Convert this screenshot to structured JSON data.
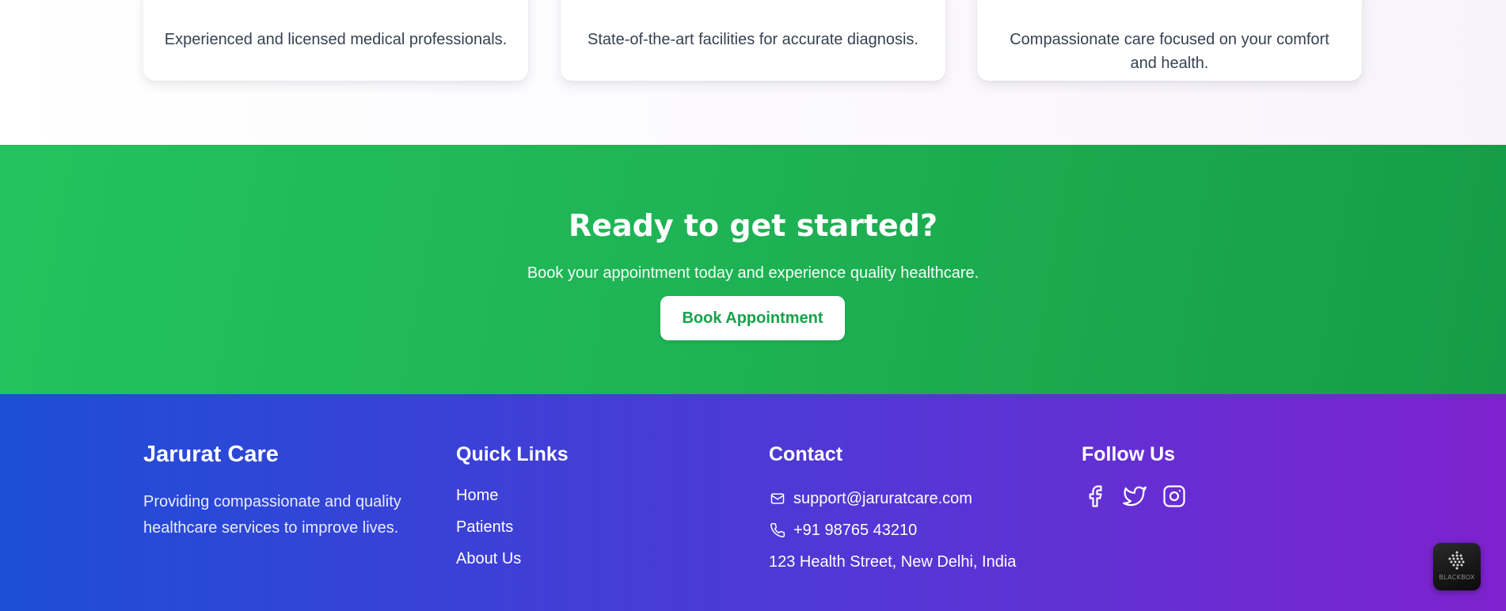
{
  "features": {
    "cards": [
      {
        "text": "Experienced and licensed medical professionals."
      },
      {
        "text": "State-of-the-art facilities for accurate diagnosis."
      },
      {
        "text": "Compassionate care focused on your comfort and health."
      }
    ]
  },
  "cta": {
    "title": "Ready to get started?",
    "subtitle": "Book your appointment today and experience quality healthcare.",
    "button_label": "Book Appointment"
  },
  "footer": {
    "brand": {
      "name": "Jarurat Care",
      "tagline": "Providing compassionate and quality healthcare services to improve lives."
    },
    "quick_links": {
      "title": "Quick Links",
      "items": [
        "Home",
        "Patients",
        "About Us"
      ]
    },
    "contact": {
      "title": "Contact",
      "email": "support@jaruratcare.com",
      "phone": "+91 98765 43210",
      "address": "123 Health Street, New Delhi, India",
      "icons": [
        "mail-icon",
        "phone-icon"
      ]
    },
    "social": {
      "title": "Follow Us",
      "icons": [
        "facebook-icon",
        "twitter-icon",
        "instagram-icon"
      ]
    }
  },
  "widget": {
    "label": "BLACKBOX"
  },
  "colors": {
    "cta_green": "#22c35e",
    "button_text_green": "#16a34a",
    "footer_blue": "#1d4ed8",
    "footer_purple": "#7e22ce",
    "card_heading_blue": "#1d4ed8"
  }
}
